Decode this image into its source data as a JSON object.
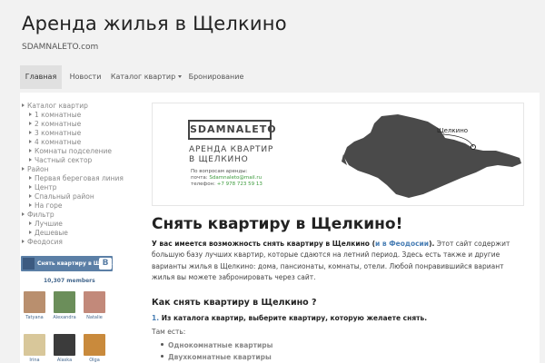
{
  "site": {
    "title": "Аренда жилья в Щелкино",
    "description": "SDAMNALETO.com"
  },
  "nav": {
    "items": [
      "Главная",
      "Новости",
      "Каталог квартир",
      "Бронирование"
    ]
  },
  "sidebar": {
    "categories": [
      {
        "label": "Каталог квартир",
        "level": 0
      },
      {
        "label": "1 комнатные",
        "level": 1
      },
      {
        "label": "2 комнатные",
        "level": 1
      },
      {
        "label": "3 комнатные",
        "level": 1
      },
      {
        "label": "4 комнатные",
        "level": 1
      },
      {
        "label": "Комнаты подселение",
        "level": 1
      },
      {
        "label": "Частный сектор",
        "level": 1
      },
      {
        "label": "Район",
        "level": 0
      },
      {
        "label": "Первая береговая линия",
        "level": 1
      },
      {
        "label": "Центр",
        "level": 1
      },
      {
        "label": "Спальный район",
        "level": 1
      },
      {
        "label": "На горе",
        "level": 1
      },
      {
        "label": "Фильтр",
        "level": 0
      },
      {
        "label": "Лучшие",
        "level": 1
      },
      {
        "label": "Дешевые",
        "level": 1
      },
      {
        "label": "Феодосия",
        "level": 0
      }
    ]
  },
  "vk": {
    "title": "Снять квартиру в Щел...",
    "logo": "B",
    "members": "10,307 members",
    "people": [
      {
        "name": "Tatyana",
        "color": "#b98f6e"
      },
      {
        "name": "Alexandra",
        "color": "#6b8e5a"
      },
      {
        "name": "Natalie",
        "color": "#c2897a"
      },
      {
        "name": "Irina",
        "color": "#d8c79a"
      },
      {
        "name": "Alaska",
        "color": "#3b3b3b"
      },
      {
        "name": "Olga",
        "color": "#c98a3c"
      }
    ]
  },
  "banner": {
    "brand": "SDAMNALETO",
    "line1": "АРЕНДА КВАРТИР",
    "line2": "В ЩЕЛКИНО",
    "contact_heading": "По вопросам аренды:",
    "email_label": "почта:",
    "email": "Sdamnaleto@mail.ru",
    "phone_label": "телефон:",
    "phone": "+7 978 723 59 13",
    "town": "Щелкино"
  },
  "main": {
    "heading": "Снять квартиру в Щелкино!",
    "intro_bold": "У вас имеется возможность снять квартиру в Щелкино (",
    "intro_link": "и в Феодосии",
    "intro_bold_end": ").",
    "intro_rest": " Этот сайт содержит большую базу лучших квартир, которые сдаются на летний период. Здесь есть также и другие варианты жилья в Щелкино: дома, пансионаты, комнаты, отели. Любой понравившийся вариант жилья вы можете забронировать через сайт.",
    "subheading": "Как снять квартиру в Щелкино ?",
    "step_num": "1.",
    "step_text": "Из каталога квартир, выберите квартиру, которую желаете снять.",
    "there_is": "Там есть:",
    "list": [
      "Однокомнатные квартиры",
      "Двухкомнатные квартиры"
    ]
  },
  "colors": {
    "accent_link": "#4a7fb5",
    "vk_blue": "#5b7fa6",
    "green": "#3d9b3d"
  }
}
